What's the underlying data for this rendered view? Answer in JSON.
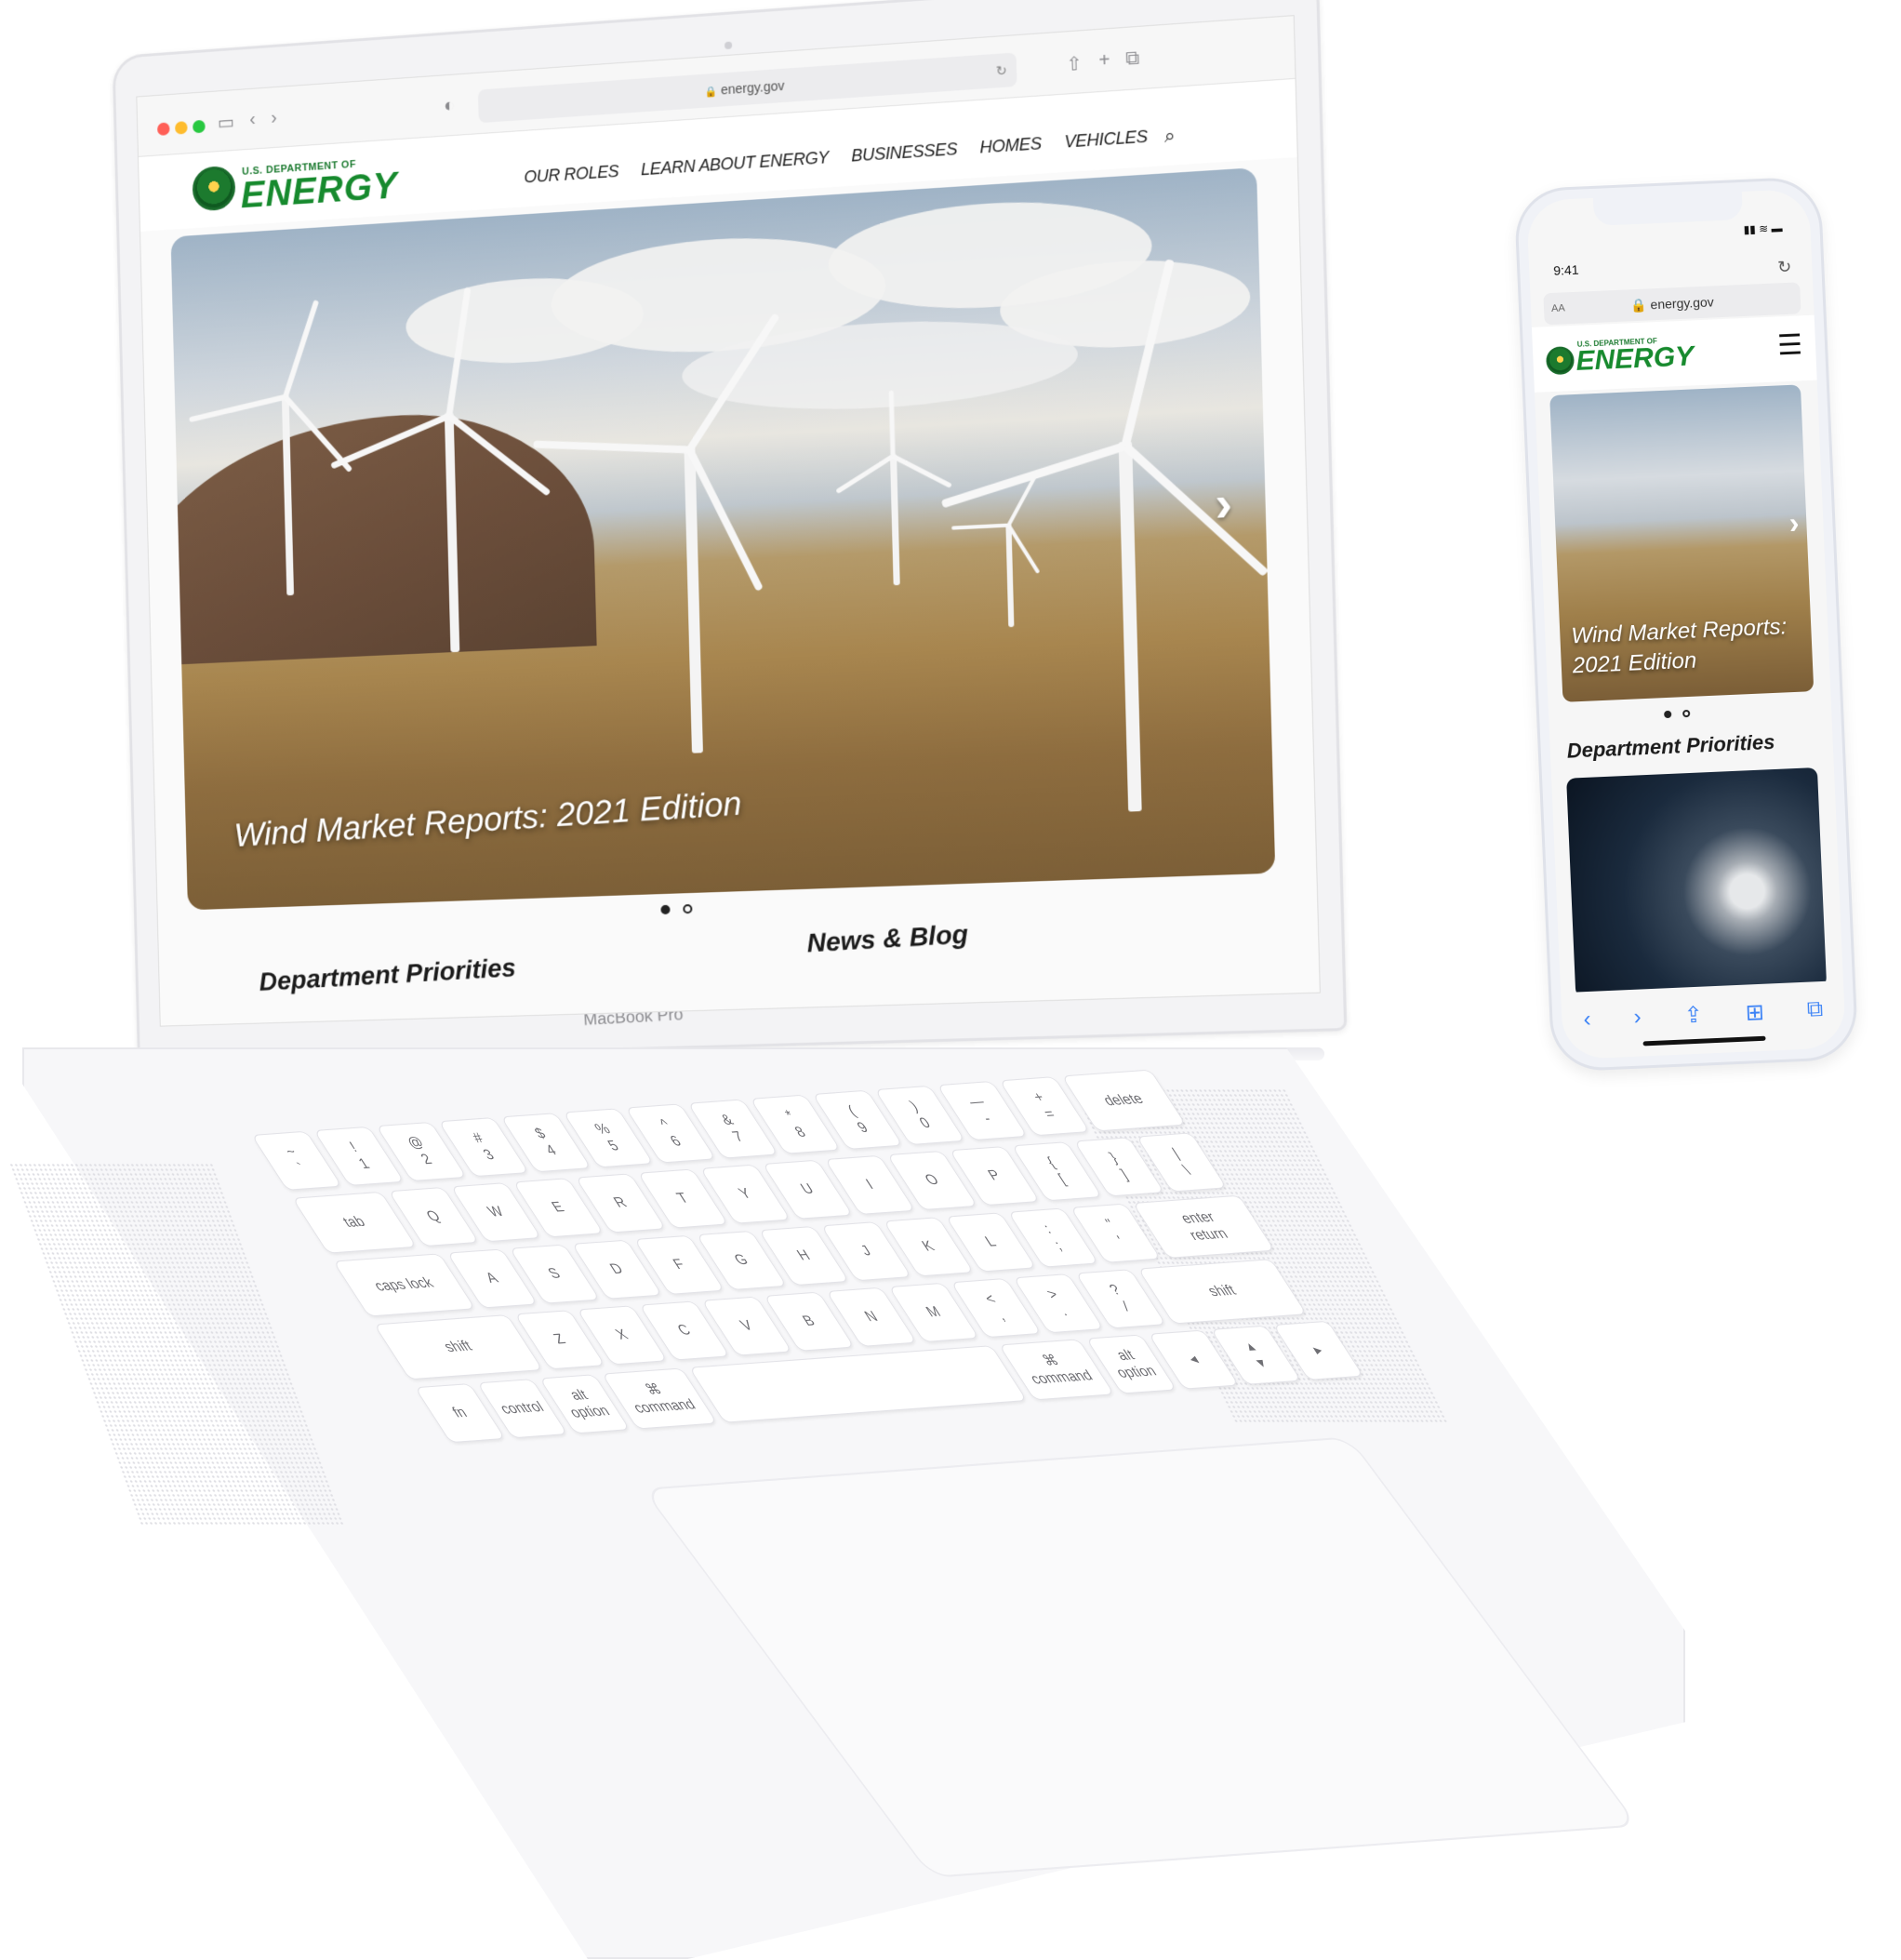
{
  "browser": {
    "url": "energy.gov",
    "icons": [
      "sidebar-icon",
      "back-icon",
      "forward-icon",
      "shield-icon",
      "share-icon",
      "new-tab-icon",
      "tabs-icon"
    ]
  },
  "site": {
    "logo_small": "U.S. DEPARTMENT OF",
    "logo_big": "ENERGY",
    "nav": [
      "OUR ROLES",
      "LEARN ABOUT ENERGY",
      "BUSINESSES",
      "HOMES",
      "VEHICLES"
    ],
    "hero_title": "Wind Market Reports: 2021 Edition",
    "sections": {
      "priorities": "Department Priorities",
      "news": "News & Blog"
    }
  },
  "device": {
    "label": "MacBook Pro"
  },
  "keyboard": {
    "rows": [
      [
        "~\n`",
        "!\n1",
        "@\n2",
        "#\n3",
        "$\n4",
        "%\n5",
        "^\n6",
        "&\n7",
        "*\n8",
        "(\n9",
        ")\n0",
        "—\n-",
        "+\n=",
        "delete"
      ],
      [
        "tab",
        "Q",
        "W",
        "E",
        "R",
        "T",
        "Y",
        "U",
        "I",
        "O",
        "P",
        "{\n[",
        "}\n]",
        "|\n\\"
      ],
      [
        "caps lock",
        "A",
        "S",
        "D",
        "F",
        "G",
        "H",
        "J",
        "K",
        "L",
        ":\n;",
        "\"\n'",
        "enter\nreturn"
      ],
      [
        "shift",
        "Z",
        "X",
        "C",
        "V",
        "B",
        "N",
        "M",
        "<\n,",
        ">\n.",
        "?\n/",
        "shift"
      ],
      [
        "fn",
        "control",
        "alt\noption",
        "⌘\ncommand",
        "",
        "⌘\ncommand",
        "alt\noption",
        "◂",
        "▴\n▾",
        "▸"
      ]
    ]
  },
  "phone": {
    "time": "9:41",
    "url": "energy.gov",
    "aa": "AA",
    "logo_small": "U.S. DEPARTMENT OF",
    "logo_big": "ENERGY",
    "hero_title": "Wind Market Reports: 2021 Edition",
    "section": "Department Priorities"
  },
  "colors": {
    "brand_green": "#178a2e",
    "accent_blue": "#3b82f6"
  }
}
